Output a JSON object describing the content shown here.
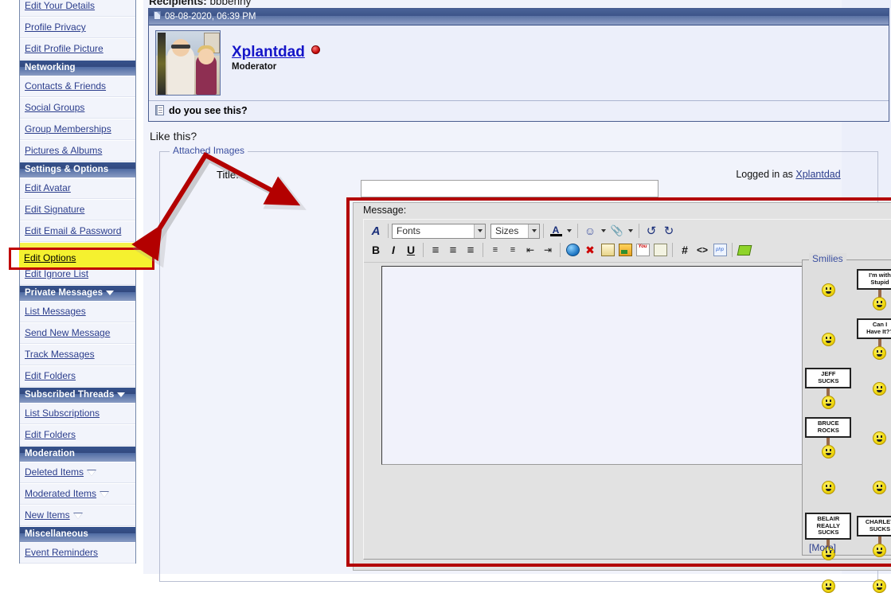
{
  "sidebar": {
    "groups": [
      {
        "type": "item",
        "label": "Edit Your Details"
      },
      {
        "type": "item",
        "label": "Profile Privacy"
      },
      {
        "type": "item",
        "label": "Edit Profile Picture"
      },
      {
        "type": "header",
        "label": "Networking"
      },
      {
        "type": "item",
        "label": "Contacts & Friends"
      },
      {
        "type": "item",
        "label": "Social Groups"
      },
      {
        "type": "item",
        "label": "Group Memberships"
      },
      {
        "type": "item",
        "label": "Pictures & Albums"
      },
      {
        "type": "header",
        "label": "Settings & Options"
      },
      {
        "type": "item",
        "label": "Edit Avatar"
      },
      {
        "type": "item",
        "label": "Edit Signature"
      },
      {
        "type": "item",
        "label": "Edit Email & Password"
      },
      {
        "type": "item",
        "label": "Edit Options",
        "highlighted": true
      },
      {
        "type": "item",
        "label": "Edit Ignore List"
      },
      {
        "type": "header",
        "label": "Private Messages",
        "caret": true
      },
      {
        "type": "item",
        "label": "List Messages"
      },
      {
        "type": "item",
        "label": "Send New Message"
      },
      {
        "type": "item",
        "label": "Track Messages"
      },
      {
        "type": "item",
        "label": "Edit Folders"
      },
      {
        "type": "header",
        "label": "Subscribed Threads",
        "caret": true
      },
      {
        "type": "item",
        "label": "List Subscriptions"
      },
      {
        "type": "item",
        "label": "Edit Folders"
      },
      {
        "type": "header",
        "label": "Moderation"
      },
      {
        "type": "item",
        "label": "Deleted Items",
        "caret": true
      },
      {
        "type": "item",
        "label": "Moderated Items",
        "caret": true
      },
      {
        "type": "item",
        "label": "New Items",
        "caret": true
      },
      {
        "type": "header",
        "label": "Miscellaneous"
      },
      {
        "type": "item",
        "label": "Event Reminders"
      }
    ],
    "highlight_label": "Edit Options"
  },
  "recipients": {
    "label": "Recipients",
    "separator": ": ",
    "value": "bbbenny"
  },
  "post": {
    "date": "08-08-2020, 06:39 PM",
    "username": "Xplantdad",
    "usertitle": "Moderator",
    "subject": "do you see this?"
  },
  "body_text": "Like this?",
  "attached": {
    "legend": "Attached Images",
    "title_label": "Title:",
    "title_value": ""
  },
  "session": {
    "logged_in_prefix": "Logged in as ",
    "user": "Xplantdad"
  },
  "editor": {
    "message_label": "Message:",
    "fonts_placeholder": "Fonts",
    "sizes_placeholder": "Sizes",
    "message_value": "",
    "toolbar_row1": [
      {
        "name": "remove-formatting-icon",
        "glyph": "A"
      },
      {
        "name": "font-family-select",
        "glyph": "Fonts"
      },
      {
        "name": "font-size-select",
        "glyph": "Sizes"
      },
      {
        "name": "font-color-button",
        "glyph": "A"
      },
      {
        "name": "smilie-button",
        "glyph": "☺"
      },
      {
        "name": "attachment-button",
        "glyph": "🖇"
      },
      {
        "name": "undo-button",
        "glyph": "↶"
      },
      {
        "name": "redo-button",
        "glyph": "↷"
      }
    ],
    "toolbar_row2": [
      {
        "name": "bold-button",
        "glyph": "B"
      },
      {
        "name": "italic-button",
        "glyph": "I"
      },
      {
        "name": "underline-button",
        "glyph": "U"
      },
      {
        "name": "align-left-button",
        "glyph": "≡"
      },
      {
        "name": "align-center-button",
        "glyph": "≡"
      },
      {
        "name": "align-right-button",
        "glyph": "≡"
      },
      {
        "name": "ordered-list-button",
        "glyph": "1."
      },
      {
        "name": "unordered-list-button",
        "glyph": "•"
      },
      {
        "name": "outdent-button",
        "glyph": "⇤"
      },
      {
        "name": "indent-button",
        "glyph": "⇥"
      },
      {
        "name": "insert-link-button",
        "glyph": ""
      },
      {
        "name": "remove-link-button",
        "glyph": ""
      },
      {
        "name": "insert-email-button",
        "glyph": ""
      },
      {
        "name": "insert-image-button",
        "glyph": ""
      },
      {
        "name": "insert-video-button",
        "glyph": ""
      },
      {
        "name": "wrap-quotes-button",
        "glyph": ""
      },
      {
        "name": "insert-code-button",
        "glyph": "#"
      },
      {
        "name": "insert-html-button",
        "glyph": "<>"
      },
      {
        "name": "insert-php-button",
        "glyph": "php"
      },
      {
        "name": "insert-gem-button",
        "glyph": ""
      }
    ],
    "mode_button": "A",
    "smilies": {
      "legend": "Smilies",
      "more_label": "[More]",
      "items": [
        {
          "kind": "face",
          "name": "smilie-confused"
        },
        {
          "kind": "sign",
          "name": "smilie-im-with-stupid",
          "text": "I'm with\nStupid"
        },
        {
          "kind": "face",
          "name": "smilie-cool"
        },
        {
          "kind": "face",
          "name": "smilie-pray"
        },
        {
          "kind": "sign",
          "name": "smilie-can-i-have-it",
          "text": "Can I\nHave It??"
        },
        {
          "kind": "face",
          "name": "smilie-grin"
        },
        {
          "kind": "sign",
          "name": "smilie-jeff-sucks",
          "text": "JEFF\nSUCKS"
        },
        {
          "kind": "face",
          "name": "smilie-surprised"
        },
        {
          "kind": "face",
          "name": "smilie-dead"
        },
        {
          "kind": "sign",
          "name": "smilie-bruce-rocks",
          "text": "BRUCE\nROCKS"
        },
        {
          "kind": "face",
          "name": "smilie-hug"
        },
        {
          "kind": "face",
          "name": "smilie-wave"
        },
        {
          "kind": "face",
          "name": "smilie-eek"
        },
        {
          "kind": "face",
          "name": "smilie-thumbsdown"
        },
        {
          "kind": "face",
          "name": "smilie-sick"
        },
        {
          "kind": "sign",
          "name": "smilie-belair-really-sucks",
          "text": "BELAIR\nREALLY SUCKS"
        },
        {
          "kind": "sign",
          "name": "smilie-charley-sucks",
          "text": "CHARLEY\nSUCKS"
        },
        {
          "kind": "face",
          "name": "smilie-laugh"
        },
        {
          "kind": "face",
          "name": "smilie-wink"
        },
        {
          "kind": "face",
          "name": "smilie-confused-question"
        }
      ]
    }
  },
  "colors": {
    "nav_header": "#37538d",
    "link": "#2b3d8c",
    "annotation": "#b30000",
    "highlight": "#f5f12f",
    "page_bg": "#f1f3fb"
  }
}
